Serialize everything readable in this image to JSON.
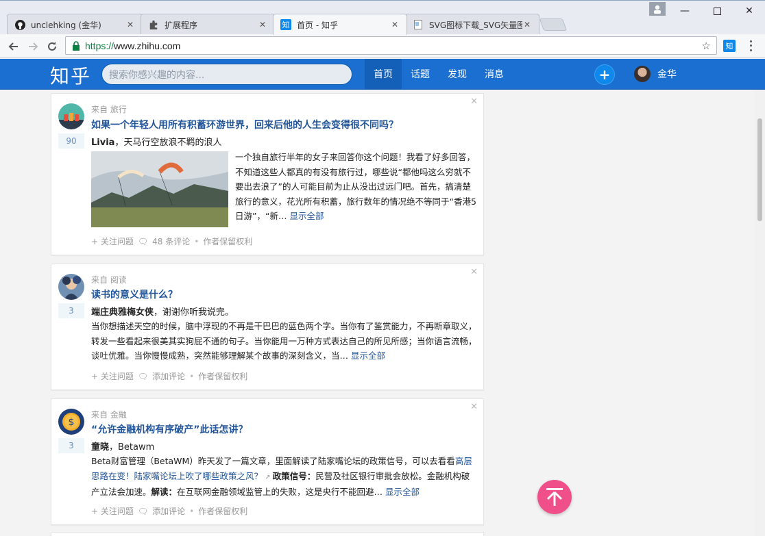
{
  "browser": {
    "tabs": [
      {
        "title": "unclehking (金华)",
        "icon": "github-icon"
      },
      {
        "title": "扩展程序",
        "icon": "puzzle-icon"
      },
      {
        "title": "首页 - 知乎",
        "icon": "zhihu-icon",
        "active": true
      },
      {
        "title": "SVG图标下载_SVG矢量图",
        "icon": "page-icon"
      }
    ],
    "zhihu_favicon_text": "知",
    "url_scheme": "https://",
    "url_host": "www.zhihu.com",
    "ext_text": "知"
  },
  "header": {
    "logo": "知乎",
    "search_placeholder": "搜索你感兴趣的内容...",
    "nav": [
      "首页",
      "话题",
      "发现",
      "消息"
    ],
    "plus": "+",
    "username": "金华"
  },
  "feed": [
    {
      "source": "来自 旅行",
      "title": "如果一个年轻人用所有积蓄环游世界，回来后他的人生会变得很不同吗？",
      "votes": "90",
      "author_name": "Livia",
      "author_bio": "，天马行空放浪不羁的浪人",
      "excerpt": "一个独自旅行半年的女子来回答你这个问题！我看了好多回答，不知道这些人都真的有没有旅行过，哪些说“都他吗这么穷就不要出去浪了”的人可能目前为止从没出过远门吧。首先，搞清楚旅行的意义，花光所有积蓄，旅行数年的情况绝不等同于“香港5日游”，“新…",
      "more": "显示全部",
      "follow": "+ 关注问题",
      "comments": "48 条评论",
      "rights": "作者保留权利"
    },
    {
      "source": "来自 阅读",
      "title": "读书的意义是什么？",
      "votes": "3",
      "author_name": "端庄典雅梅女侠",
      "author_bio": "，谢谢你听我说完。",
      "excerpt": "当你想描述天空的时候，脑中浮现的不再是干巴巴的蓝色两个字。当你有了鉴赏能力，不再断章取义，转发一些看起来很美其实狗屁不通的句子。当你能用一万种方式表达自己的所见所感；当你语言流畅，谈吐优雅。当你慢慢成熟，突然能够理解某个故事的深刻含义，当…",
      "more": "显示全部",
      "follow": "+ 关注问题",
      "comments": "添加评论",
      "rights": "作者保留权利"
    },
    {
      "source": "来自 金融",
      "title": "“允许金融机构有序破产”此话怎讲？",
      "votes": "3",
      "author_name": "童晓",
      "author_bio": "，Betawm",
      "excerpt_a": "Beta财富管理（BetaWM）昨天发了一篇文章，里面解读了陆家嘴论坛的政策信号，可以去看看",
      "excerpt_link": "高层思路在变！陆家嘴论坛上吹了哪些政策之风？",
      "excerpt_b1": "政策信号：",
      "excerpt_c": "民营及社区银行审批会放松。金融机构破产立法会加速。",
      "excerpt_b2": "解读：",
      "excerpt_d": "在互联网金融领域监管上的失败，这是央行不能回避…",
      "more": "显示全部",
      "follow": "+ 关注问题",
      "comments": "添加评论",
      "rights": "作者保留权利"
    }
  ]
}
